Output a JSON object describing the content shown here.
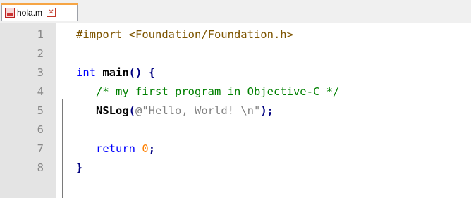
{
  "tab": {
    "label": "hola.m",
    "file_icon": "file-modified-icon",
    "close_icon": "close-icon"
  },
  "editor": {
    "lines": [
      {
        "num": "1",
        "tokens": [
          {
            "t": "#import <Foundation/Foundation.h>",
            "c": "pp"
          }
        ]
      },
      {
        "num": "2",
        "tokens": []
      },
      {
        "num": "3",
        "tokens": [
          {
            "t": "int",
            "c": "kw"
          },
          {
            "t": " main",
            "c": "bold"
          },
          {
            "t": "()",
            "c": "op"
          },
          {
            "t": " ",
            "c": ""
          },
          {
            "t": "{",
            "c": "op"
          }
        ]
      },
      {
        "num": "4",
        "tokens": [
          {
            "t": "   ",
            "c": ""
          },
          {
            "t": "/* my first program in Objective-C */",
            "c": "cm"
          }
        ]
      },
      {
        "num": "5",
        "tokens": [
          {
            "t": "   ",
            "c": ""
          },
          {
            "t": "NSLog",
            "c": "bold"
          },
          {
            "t": "(",
            "c": "op"
          },
          {
            "t": "@\"Hello, World! \\n\"",
            "c": "str"
          },
          {
            "t": ");",
            "c": "op"
          }
        ]
      },
      {
        "num": "6",
        "tokens": []
      },
      {
        "num": "7",
        "tokens": [
          {
            "t": "   ",
            "c": ""
          },
          {
            "t": "return",
            "c": "kw"
          },
          {
            "t": " ",
            "c": ""
          },
          {
            "t": "0",
            "c": "num"
          },
          {
            "t": ";",
            "c": "op"
          }
        ]
      },
      {
        "num": "8",
        "tokens": [
          {
            "t": "}",
            "c": "op"
          }
        ]
      }
    ]
  },
  "colors": {
    "keyword": "#0000ff",
    "comment": "#008000",
    "string": "#808080",
    "number": "#ff8000",
    "preprocessor": "#7d5400",
    "operator": "#000080",
    "tab_accent": "#f6a545"
  }
}
